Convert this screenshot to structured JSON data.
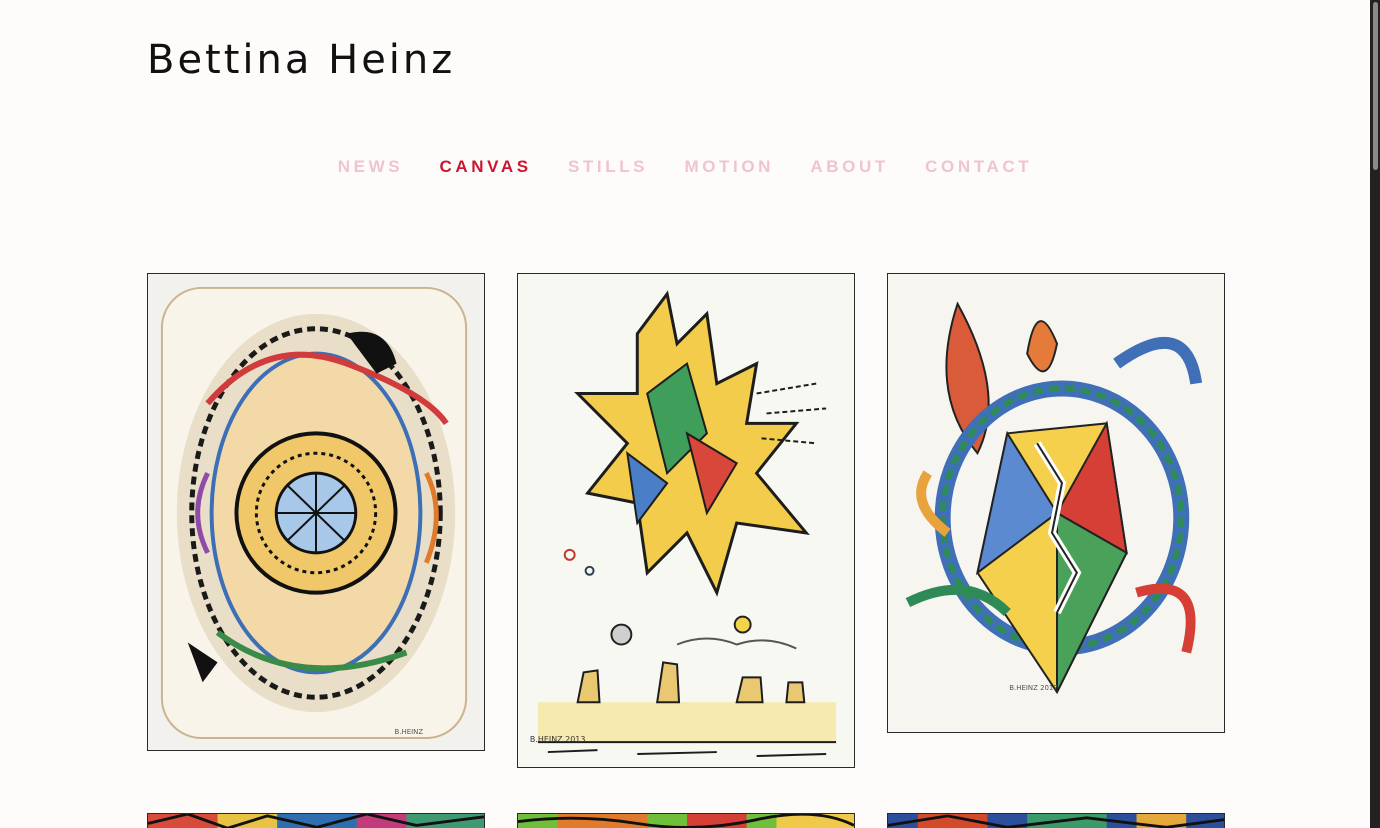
{
  "site": {
    "title": "Bettina Heinz"
  },
  "nav": {
    "items": [
      {
        "label": "NEWS",
        "active": false
      },
      {
        "label": "CANVAS",
        "active": true
      },
      {
        "label": "STILLS",
        "active": false
      },
      {
        "label": "MOTION",
        "active": false
      },
      {
        "label": "ABOUT",
        "active": false
      },
      {
        "label": "CONTACT",
        "active": false
      }
    ]
  },
  "colors": {
    "nav_active": "#cc1530",
    "nav_inactive": "#efc4cc",
    "title": "#111111",
    "background": "#fefcfb"
  },
  "gallery": {
    "artworks": [
      {
        "signature": "B.HEINZ"
      },
      {
        "signature": "B.HEINZ 2013"
      },
      {
        "signature": "B.HEINZ 2017"
      },
      {
        "signature": ""
      },
      {
        "signature": ""
      },
      {
        "signature": ""
      }
    ]
  }
}
